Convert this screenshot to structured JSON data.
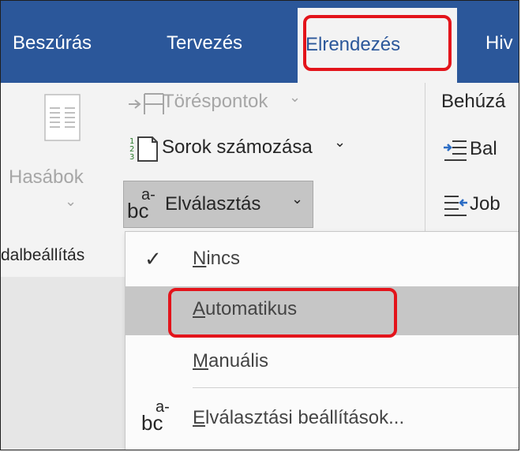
{
  "tabs": [
    {
      "label": "Beszúrás",
      "active": false
    },
    {
      "label": "Tervezés",
      "active": false
    },
    {
      "label": "Elrendezés",
      "active": true
    },
    {
      "label": "Hiv",
      "active": false
    }
  ],
  "page_setup": {
    "columns_label": "Hasábok",
    "columns_chevron": "⌄",
    "breaks_label": "Töréspontok",
    "line_numbers_label": "Sorok számozása",
    "hyphenation_label": "Elválasztás",
    "dropdown_chevron": "⌄",
    "group_label": "dalbeállítás"
  },
  "paragraph": {
    "indent_label": "Behúzá",
    "left_label": "Bal",
    "right_label": "Job"
  },
  "hyphenation_menu": {
    "items": [
      {
        "access_key": "N",
        "rest": "incs",
        "checked": true
      },
      {
        "access_key": "A",
        "rest": "utomatikus",
        "highlighted": true
      },
      {
        "access_key": "M",
        "rest": "anuális"
      },
      {
        "access_key": "E",
        "rest": "lválasztási beállítások..."
      }
    ]
  },
  "icons": {
    "hyphenation_glyph_top": "a-",
    "hyphenation_glyph_bottom": "bc",
    "checkmark": "✓"
  },
  "colors": {
    "ribbon_tab_bg": "#2b579a",
    "highlight_outline": "#e3141b",
    "menu_hover": "#c6c6c6"
  }
}
